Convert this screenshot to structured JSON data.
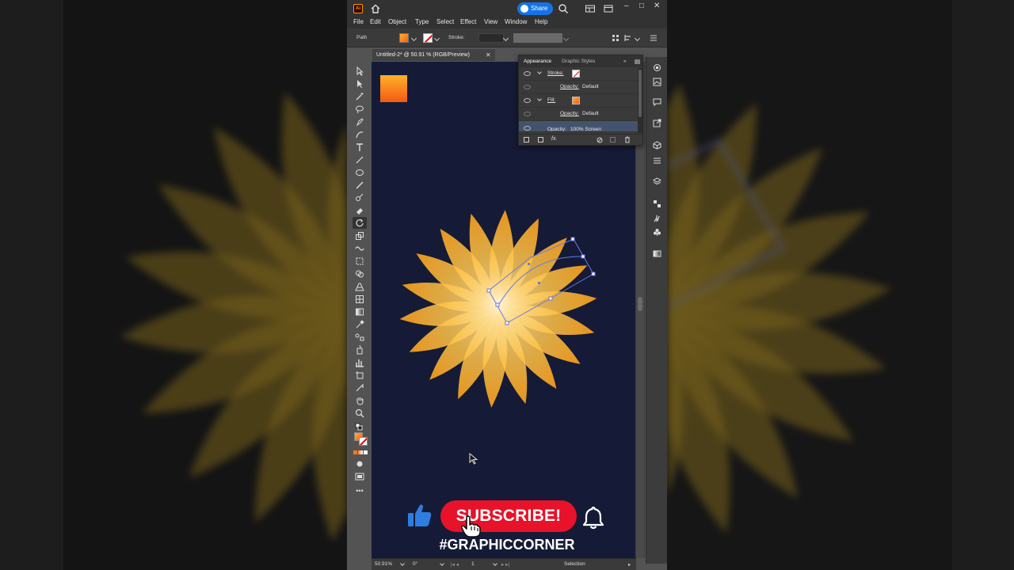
{
  "app": {
    "logo_text": "Ai",
    "share_label": "Share",
    "window_controls": [
      "–",
      "□",
      "✕"
    ]
  },
  "menu": [
    "File",
    "Edit",
    "Object",
    "Type",
    "Select",
    "Effect",
    "View",
    "Window",
    "Help"
  ],
  "control_bar": {
    "selection_label": "Path",
    "stroke_label": "Stroke:"
  },
  "document": {
    "tab_title": "Untitled-2* @ 50.91 % (RGB/Preview)",
    "tab_close": "✕"
  },
  "appearance_panel": {
    "tabs": [
      "Appearance",
      "Graphic Styles"
    ],
    "rows": [
      {
        "label": "Stroke:",
        "value": ""
      },
      {
        "label": "Opacity:",
        "value": "Default"
      },
      {
        "label": "Fill:",
        "value": ""
      },
      {
        "label": "Opacity:",
        "value": "Default"
      },
      {
        "label": "Opacity:",
        "value": "100% Screen"
      }
    ],
    "footer_fx": "fx."
  },
  "status_bar": {
    "zoom": "50.91%",
    "rotation": "0°",
    "artboard": "1",
    "mode": "Selection"
  },
  "overlay": {
    "subscribe_label": "SUBSCRIBE!",
    "hashtag": "#GRAPHICCORNER"
  },
  "colors": {
    "artboard_bg": "#151b36",
    "petal_light": "#ffe39a",
    "petal_dark": "#ffb020",
    "subscribe_red": "#e8122a",
    "accent_blue": "#1473e6"
  }
}
